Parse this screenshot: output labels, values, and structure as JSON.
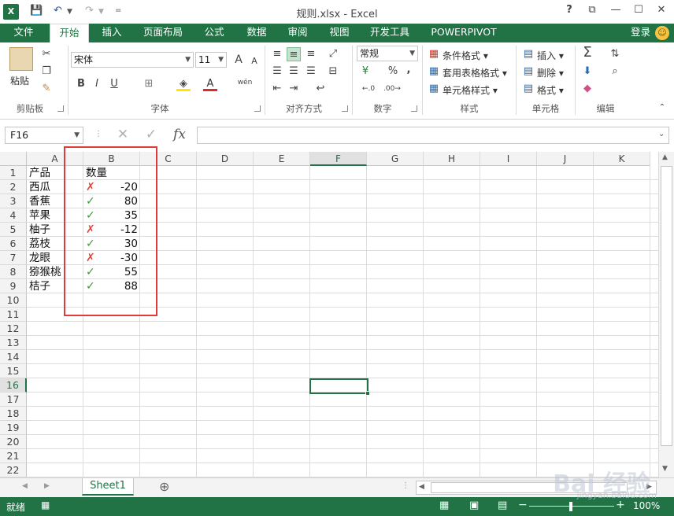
{
  "window": {
    "title": "规则.xlsx - Excel",
    "help": "?",
    "minimize": "—",
    "maximize": "☐",
    "close": "✕",
    "ribbon_display": "⧉"
  },
  "qat": {
    "save": "💾",
    "undo": "↶",
    "redo": "↷",
    "customize": "="
  },
  "tabs": [
    "文件",
    "开始",
    "插入",
    "页面布局",
    "公式",
    "数据",
    "审阅",
    "视图",
    "开发工具",
    "POWERPIVOT"
  ],
  "active_tab": "开始",
  "login": "登录",
  "ribbon": {
    "clipboard": {
      "paste": "粘贴",
      "label": "剪贴板"
    },
    "font": {
      "name": "宋体",
      "size": "11",
      "bold": "B",
      "italic": "I",
      "underline": "U",
      "grow": "A",
      "shrink": "A",
      "font_color": "A",
      "wen": "wén",
      "label": "字体"
    },
    "align": {
      "label": "对齐方式"
    },
    "number": {
      "format": "常规",
      "label": "数字",
      "percent": "%",
      "comma": ",",
      "inc": "←.0",
      "dec": ".00→"
    },
    "styles": {
      "cond": "条件格式",
      "table": "套用表格格式",
      "cell": "单元格样式",
      "label": "样式"
    },
    "cells": {
      "insert": "插入",
      "delete": "删除",
      "format": "格式",
      "label": "单元格"
    },
    "editing": {
      "label": "编辑",
      "sum": "Σ"
    }
  },
  "formula_bar": {
    "name_box": "F16",
    "cancel": "✕",
    "enter": "✓",
    "fx": "fx",
    "value": ""
  },
  "columns": [
    "A",
    "B",
    "C",
    "D",
    "E",
    "F",
    "G",
    "H",
    "I",
    "J",
    "K"
  ],
  "selected_column": "F",
  "rows": [
    "1",
    "2",
    "3",
    "4",
    "5",
    "6",
    "7",
    "8",
    "9",
    "10",
    "11",
    "12",
    "13",
    "14",
    "15",
    "16",
    "17",
    "18",
    "19",
    "20",
    "21",
    "22"
  ],
  "selected_row": "16",
  "header": {
    "a": "产品",
    "b": "数量"
  },
  "data": [
    {
      "product": "西瓜",
      "qty": "-20",
      "mark": "✗"
    },
    {
      "product": "香蕉",
      "qty": "80",
      "mark": "✓"
    },
    {
      "product": "苹果",
      "qty": "35",
      "mark": "✓"
    },
    {
      "product": "柚子",
      "qty": "-12",
      "mark": "✗"
    },
    {
      "product": "荔枝",
      "qty": "30",
      "mark": "✓"
    },
    {
      "product": "龙眼",
      "qty": "-30",
      "mark": "✗"
    },
    {
      "product": "猕猴桃",
      "qty": "55",
      "mark": "✓"
    },
    {
      "product": "桔子",
      "qty": "88",
      "mark": "✓"
    }
  ],
  "sheet_tab": "Sheet1",
  "add_sheet": "⊕",
  "status": {
    "ready": "就绪",
    "zoom": "100%",
    "minus": "−",
    "plus": "+"
  },
  "watermark": {
    "logo": "Bai 经验",
    "url": "jingyan.baidu.com"
  },
  "colors": {
    "excel_green": "#217346",
    "highlight_red": "#e03a3a",
    "check_green": "#3a9a3a",
    "cross_red": "#e0443a"
  }
}
